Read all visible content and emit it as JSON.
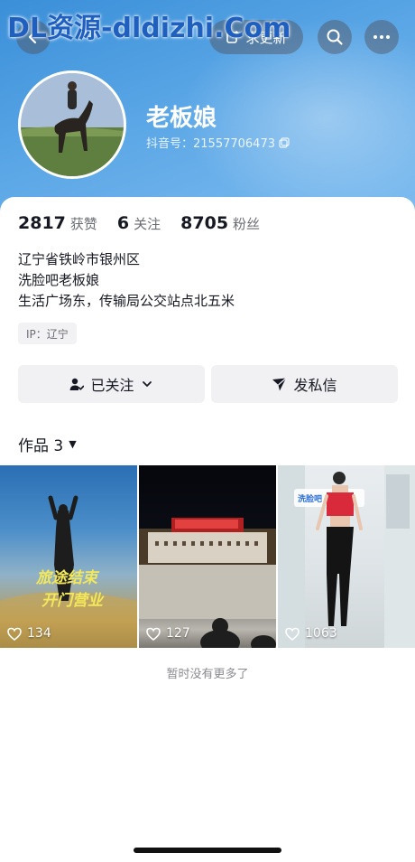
{
  "watermark": "DL资源-dldizhi.Com",
  "topbar": {
    "update_label": "求更新"
  },
  "profile": {
    "nickname": "老板娘",
    "douyin_id": "抖音号：21557706473"
  },
  "stats": [
    {
      "value": "2817",
      "label": "获赞"
    },
    {
      "value": "6",
      "label": "关注"
    },
    {
      "value": "8705",
      "label": "粉丝"
    }
  ],
  "bio": [
    "辽宁省铁岭市银州区",
    "洗脸吧老板娘",
    "生活广场东，传输局公交站点北五米"
  ],
  "ip_location": "IP：辽宁",
  "actions": {
    "follow_label": "已关注",
    "message_label": "发私信"
  },
  "works": {
    "tab_label": "作品 3",
    "videos": [
      {
        "likes": "134",
        "overlay_text_1": "旅途结束",
        "overlay_text_2": "开门营业"
      },
      {
        "likes": "127"
      },
      {
        "likes": "1063",
        "overlay_text_1": "洗脸吧"
      }
    ]
  },
  "footer_text": "暂时没有更多了"
}
